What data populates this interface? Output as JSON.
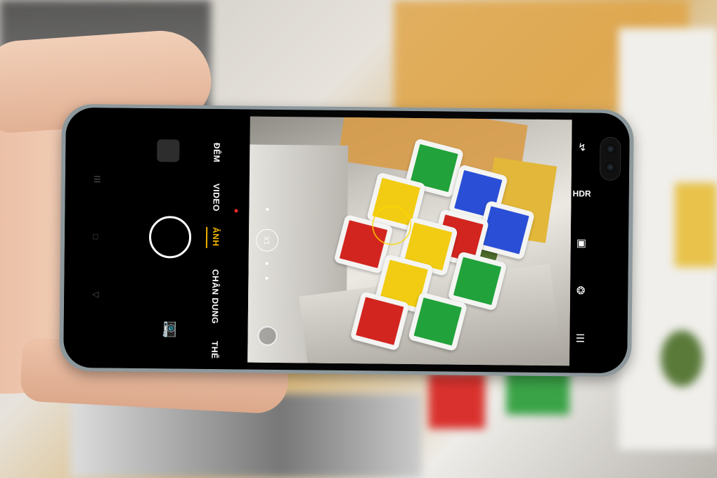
{
  "camera_modes": [
    {
      "label": "ĐÊM"
    },
    {
      "label": "VIDEO"
    },
    {
      "label": "ẢNH"
    },
    {
      "label": "CHÂN DUNG"
    },
    {
      "label": "THỂ"
    }
  ],
  "active_mode": "ẢNH",
  "zoom": {
    "label": "1X"
  },
  "right_controls": {
    "flash_icon": "flash-off-icon",
    "hdr_label": "HDR",
    "gallery_icon": "image-icon",
    "filters_icon": "filters-icon",
    "menu_icon": "menu-icon"
  },
  "left_controls": {
    "shutter_icon": "shutter-icon",
    "switch_camera_icon": "switch-camera-icon",
    "gallery_thumb": "gallery-thumbnail"
  },
  "system_nav": {
    "recents_icon": "recents-icon",
    "home_icon": "home-icon",
    "back_icon": "back-icon"
  },
  "colors": {
    "active_mode": "#f0b400",
    "record_dot": "#ff2a2a",
    "phone_frame": "#8d989c"
  }
}
